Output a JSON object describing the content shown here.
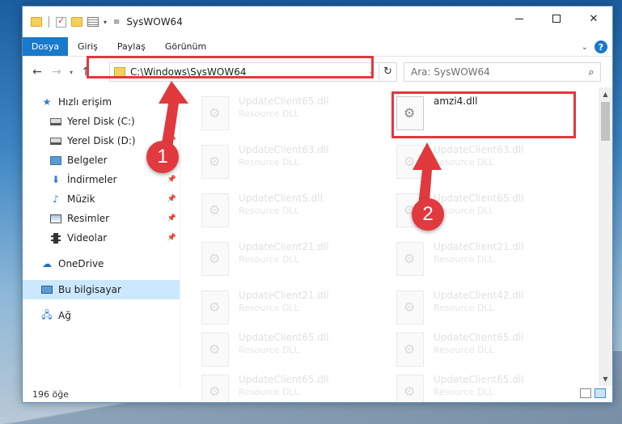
{
  "window": {
    "title": "SysWOW64"
  },
  "ribbon": {
    "tabs": [
      "Dosya",
      "Giriş",
      "Paylaş",
      "Görünüm"
    ],
    "help_label": "?"
  },
  "navbar": {
    "address": "C:\\Windows\\SysWOW64",
    "search_placeholder": "Ara: SysWOW64"
  },
  "sidebar": {
    "items": [
      {
        "label": "Hızlı erişim",
        "icon": "star-icon",
        "pinned": false
      },
      {
        "label": "Yerel Disk (C:)",
        "icon": "drive-icon",
        "pinned": true
      },
      {
        "label": "Yerel Disk (D:)",
        "icon": "drive-icon",
        "pinned": true
      },
      {
        "label": "Belgeler",
        "icon": "documents-icon",
        "pinned": true
      },
      {
        "label": "İndirmeler",
        "icon": "downloads-icon",
        "pinned": true
      },
      {
        "label": "Müzik",
        "icon": "music-icon",
        "pinned": true
      },
      {
        "label": "Resimler",
        "icon": "pictures-icon",
        "pinned": true
      },
      {
        "label": "Videolar",
        "icon": "videos-icon",
        "pinned": true
      },
      {
        "label": "OneDrive",
        "icon": "cloud-icon",
        "pinned": false
      },
      {
        "label": "Bu bilgisayar",
        "icon": "computer-icon",
        "pinned": false
      },
      {
        "label": "Ağ",
        "icon": "network-icon",
        "pinned": false
      }
    ]
  },
  "files": {
    "left_column": [
      {
        "name": "UpdateClient65.dll",
        "desc": "Resource DLL"
      },
      {
        "name": "UpdateClient63.dll",
        "desc": "Resource DLL"
      },
      {
        "name": "UpdateClient5.dll",
        "desc": "Resource DLL"
      },
      {
        "name": "UpdateClient21.dll",
        "desc": "Resource DLL"
      },
      {
        "name": "UpdateClient21.dll",
        "desc": "Resource DLL"
      },
      {
        "name": "UpdateClient65.dll",
        "desc": "Resource DLL"
      },
      {
        "name": "UpdateClient65.dll",
        "desc": "Resource DLL"
      }
    ],
    "right_column": [
      {
        "name": "amzi4.dll",
        "desc": ""
      },
      {
        "name": "UpdateClient63.dll",
        "desc": "Resource DLL"
      },
      {
        "name": "UpdateClient65.dll",
        "desc": "Resource DLL"
      },
      {
        "name": "UpdateClient21.dll",
        "desc": "Resource DLL"
      },
      {
        "name": "UpdateClient42.dll",
        "desc": "Resource DLL"
      },
      {
        "name": "UpdateClient65.dll",
        "desc": "Resource DLL"
      },
      {
        "name": "UpdateClient65.dll",
        "desc": "Resource DLL"
      }
    ]
  },
  "status": {
    "item_count": "196 öğe"
  },
  "annotations": {
    "badge1": "1",
    "badge2": "2",
    "color": "#e0393e"
  }
}
